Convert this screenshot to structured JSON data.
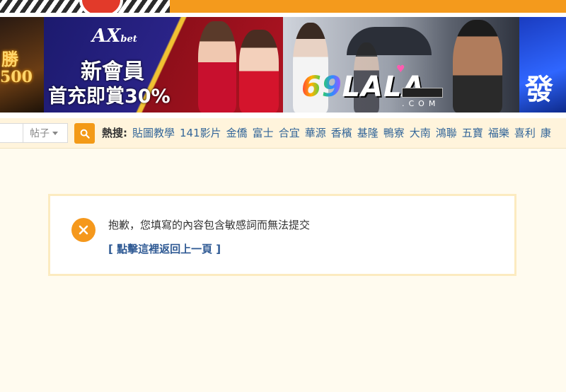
{
  "banners": {
    "left": {
      "line1": "勝",
      "line2": "500"
    },
    "axbet": {
      "logo": "AX",
      "logo_small": "bet",
      "line1": "新會員",
      "line2": "首充即賞30%"
    },
    "lala": {
      "logo_num": "69",
      "logo_text": "LALA",
      "domain": ".COM"
    },
    "right": {
      "text": "發"
    }
  },
  "search": {
    "input_value": "",
    "select_value": "帖子",
    "button_icon": "search-icon",
    "hot_label": "熱搜:",
    "hot_items": [
      "貼圖教學",
      "141影片",
      "金僑",
      "富士",
      "合宜",
      "華源",
      "香檳",
      "基隆",
      "鴨寮",
      "大南",
      "鴻聯",
      "五寶",
      "福樂",
      "喜利",
      "康"
    ]
  },
  "message": {
    "icon": "close-circle-icon",
    "text": "抱歉，您填寫的內容包含敏感詞而無法提交",
    "link": "[ 點擊這裡返回上一頁 ]"
  },
  "colors": {
    "accent": "#f39a17",
    "link": "#336699",
    "background": "#fffbef"
  }
}
